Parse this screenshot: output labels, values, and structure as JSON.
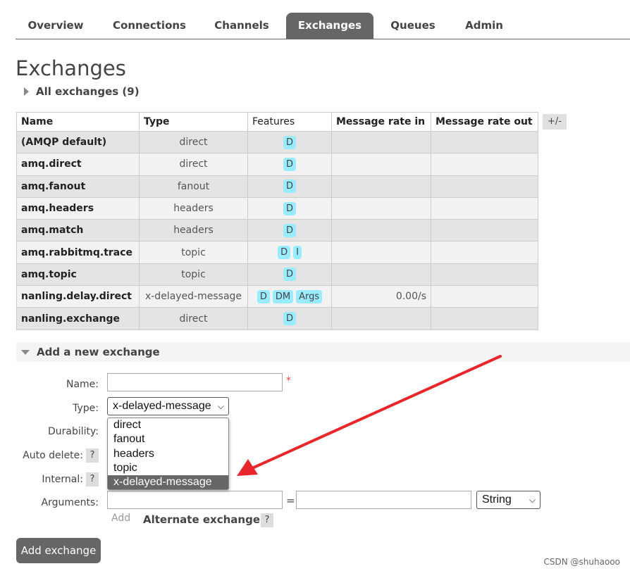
{
  "tabs": [
    "Overview",
    "Connections",
    "Channels",
    "Exchanges",
    "Queues",
    "Admin"
  ],
  "page_title": "Exchanges",
  "all_exchanges_label": "All exchanges (9)",
  "table": {
    "headers": [
      "Name",
      "Type",
      "Features",
      "Message rate in",
      "Message rate out"
    ],
    "plus_minus": "+/-",
    "rows": [
      {
        "name": "(AMQP default)",
        "type": "direct",
        "features": [
          "D"
        ],
        "rate_in": "",
        "rate_out": ""
      },
      {
        "name": "amq.direct",
        "type": "direct",
        "features": [
          "D"
        ],
        "rate_in": "",
        "rate_out": ""
      },
      {
        "name": "amq.fanout",
        "type": "fanout",
        "features": [
          "D"
        ],
        "rate_in": "",
        "rate_out": ""
      },
      {
        "name": "amq.headers",
        "type": "headers",
        "features": [
          "D"
        ],
        "rate_in": "",
        "rate_out": ""
      },
      {
        "name": "amq.match",
        "type": "headers",
        "features": [
          "D"
        ],
        "rate_in": "",
        "rate_out": ""
      },
      {
        "name": "amq.rabbitmq.trace",
        "type": "topic",
        "features": [
          "D",
          "I"
        ],
        "rate_in": "",
        "rate_out": ""
      },
      {
        "name": "amq.topic",
        "type": "topic",
        "features": [
          "D"
        ],
        "rate_in": "",
        "rate_out": ""
      },
      {
        "name": "nanling.delay.direct",
        "type": "x-delayed-message",
        "features": [
          "D",
          "DM",
          "Args"
        ],
        "rate_in": "0.00/s",
        "rate_out": ""
      },
      {
        "name": "nanling.exchange",
        "type": "direct",
        "features": [
          "D"
        ],
        "rate_in": "",
        "rate_out": ""
      }
    ]
  },
  "add_form": {
    "section_title": "Add a new exchange",
    "name_label": "Name:",
    "name_value": "",
    "required_mark": "*",
    "type_label": "Type:",
    "type_selected": "x-delayed-message",
    "type_options": [
      "direct",
      "fanout",
      "headers",
      "topic",
      "x-delayed-message"
    ],
    "durability_label": "Durability:",
    "auto_delete_label": "Auto delete:",
    "internal_label": "Internal:",
    "help_glyph": "?",
    "arguments_label": "Arguments:",
    "arg_key": "",
    "arg_eq": "=",
    "arg_value": "",
    "arg_type": "String",
    "add_link": "Add",
    "alternate_exchange_label": "Alternate exchange",
    "submit_label": "Add exchange"
  },
  "annotation": {
    "color": "#e8262b"
  },
  "watermark": "CSDN @shuhaooo"
}
